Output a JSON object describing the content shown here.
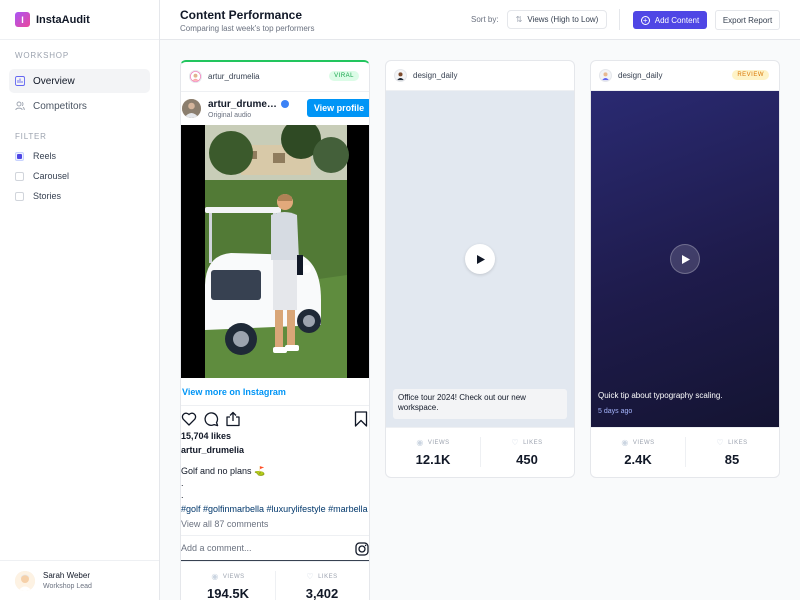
{
  "app": {
    "name": "InstaAudit",
    "logo_letter": "I"
  },
  "sidebar": {
    "workshop_label": "WORKSHOP",
    "nav": [
      {
        "label": "Overview",
        "icon": "bar-chart-icon",
        "active": true
      },
      {
        "label": "Competitors",
        "icon": "users-icon",
        "active": false
      }
    ],
    "filter_label": "FILTER",
    "filters": [
      {
        "label": "Reels",
        "checked": true
      },
      {
        "label": "Carousel",
        "checked": false
      },
      {
        "label": "Stories",
        "checked": false
      }
    ],
    "user": {
      "name": "Sarah Weber",
      "role": "Workshop Lead"
    }
  },
  "header": {
    "title": "Content Performance",
    "subtitle": "Comparing last week's top performers",
    "sort_label": "Sort by:",
    "sort_value": "Views (High to Low)",
    "add_button": "Add Content",
    "export_button": "Export Report"
  },
  "stat_labels": {
    "views": "VIEWS",
    "likes": "LIKES"
  },
  "cards": [
    {
      "account": "artur_drumelia",
      "badge": "VIRAL",
      "embed": {
        "username": "artur_drume…",
        "audio": "Original audio",
        "view_profile": "View profile",
        "view_more": "View more on Instagram",
        "likes": "15,704 likes",
        "caption_user": "artur_drumelia",
        "caption": "Golf and no plans ⛳",
        "dots": [
          ".",
          "."
        ],
        "hashtags": "#golf #golfinmarbella #luxurylifestyle #marbella",
        "view_comments": "View all 87 comments",
        "comment_placeholder": "Add a comment..."
      },
      "views": "194.5K",
      "likes": "3,402"
    },
    {
      "account": "design_daily",
      "caption": "Office tour 2024! Check out our new workspace.",
      "views": "12.1K",
      "likes": "450"
    },
    {
      "account": "design_daily",
      "badge": "REVIEW",
      "caption": "Quick tip about typography scaling.",
      "date": "5 days ago",
      "views": "2.4K",
      "likes": "85"
    }
  ],
  "colors": {
    "accent": "#4f46e5",
    "viral": "#22c55e",
    "review": "#d97706",
    "instagram_blue": "#0095f6"
  }
}
